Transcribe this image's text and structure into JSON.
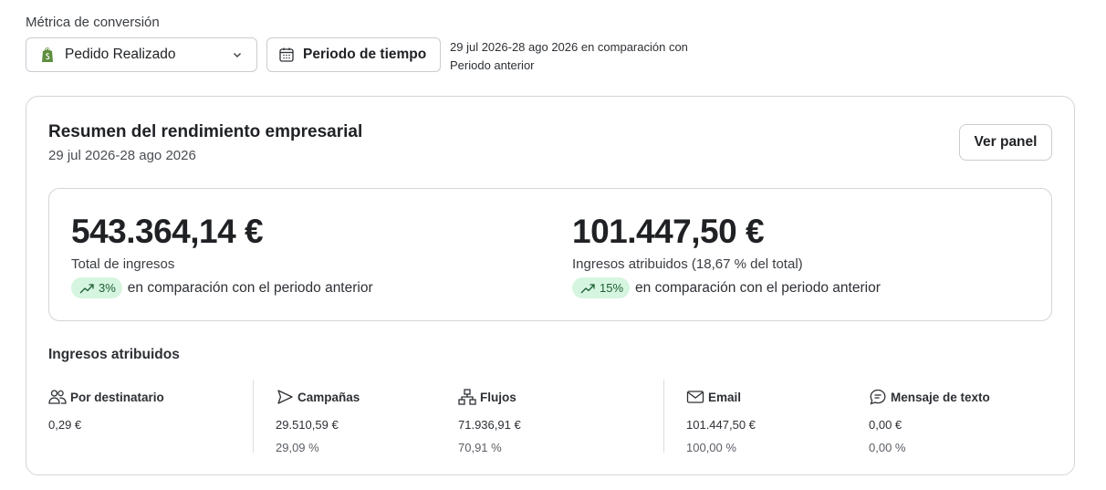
{
  "header": {
    "metric_label": "Métrica de conversión",
    "metric_selected": "Pedido Realizado",
    "period_button": "Periodo de tiempo",
    "comparison_note": "29 jul 2026-28 ago 2026 en comparación con Periodo anterior"
  },
  "summary": {
    "title": "Resumen del rendimiento empresarial",
    "date_range": "29 jul 2026-28 ago 2026",
    "view_panel_button": "Ver panel",
    "kpis": [
      {
        "value": "543.364,14 €",
        "label": "Total de ingresos",
        "change": "3%",
        "comparison": "en comparación con el periodo anterior"
      },
      {
        "value": "101.447,50 €",
        "label": "Ingresos atribuidos (18,67 % del total)",
        "change": "15%",
        "comparison": "en comparación con el periodo anterior"
      }
    ]
  },
  "attributed": {
    "title": "Ingresos atribuidos",
    "columns": [
      {
        "label": "Por destinatario",
        "icon": "recipients-icon",
        "value": "0,29 €",
        "percent": ""
      },
      {
        "label": "Campañas",
        "icon": "send-icon",
        "value": "29.510,59 €",
        "percent": "29,09 %"
      },
      {
        "label": "Flujos",
        "icon": "flow-icon",
        "value": "71.936,91 €",
        "percent": "70,91 %"
      },
      {
        "label": "Email",
        "icon": "mail-icon",
        "value": "101.447,50 €",
        "percent": "100,00 %"
      },
      {
        "label": "Mensaje de texto",
        "icon": "sms-icon",
        "value": "0,00 €",
        "percent": "0,00 %"
      }
    ]
  },
  "colors": {
    "badge_bg": "#d6f5e0",
    "badge_text": "#1d5e34",
    "shopify_green": "#5e8e3e",
    "border": "#d3d5d9"
  }
}
